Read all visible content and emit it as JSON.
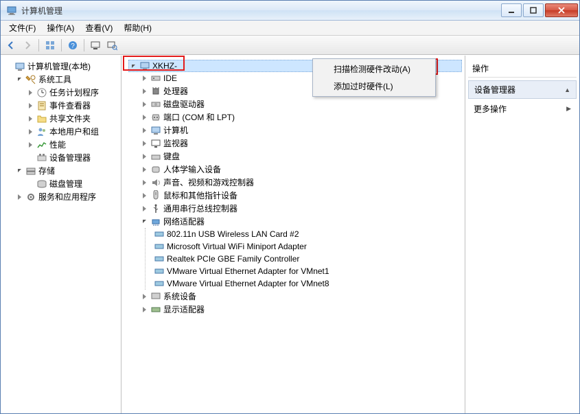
{
  "window": {
    "title": "计算机管理"
  },
  "menubar": {
    "file": "文件(F)",
    "action": "操作(A)",
    "view": "查看(V)",
    "help": "帮助(H)"
  },
  "left_tree": {
    "root": "计算机管理(本地)",
    "system_tools": "系统工具",
    "task_scheduler": "任务计划程序",
    "event_viewer": "事件查看器",
    "shared_folders": "共享文件夹",
    "local_users_groups": "本地用户和组",
    "performance": "性能",
    "device_manager": "设备管理器",
    "storage": "存储",
    "disk_management": "磁盘管理",
    "services_apps": "服务和应用程序"
  },
  "center_tree": {
    "computer_node": "XKHZ-",
    "ide": "IDE",
    "processors": "处理器",
    "disk_drives": "磁盘驱动器",
    "ports": "端口 (COM 和 LPT)",
    "computers": "计算机",
    "monitors": "监视器",
    "keyboards": "键盘",
    "hid": "人体学输入设备",
    "sound": "声音、视频和游戏控制器",
    "mice": "鼠标和其他指针设备",
    "usb": "通用串行总线控制器",
    "network_adapters": "网络适配器",
    "net1": "802.11n USB Wireless LAN Card #2",
    "net2": "Microsoft Virtual WiFi Miniport Adapter",
    "net3": "Realtek PCIe GBE Family Controller",
    "net4": "VMware Virtual Ethernet Adapter for VMnet1",
    "net5": "VMware Virtual Ethernet Adapter for VMnet8",
    "system_devices": "系统设备",
    "display_adapters": "显示适配器"
  },
  "context_menu": {
    "scan_hw": "扫描检测硬件改动(A)",
    "add_legacy": "添加过时硬件(L)"
  },
  "right_pane": {
    "header": "操作",
    "section": "设备管理器",
    "more_ops": "更多操作",
    "arrow_up": "▲",
    "arrow_right": "▶"
  }
}
